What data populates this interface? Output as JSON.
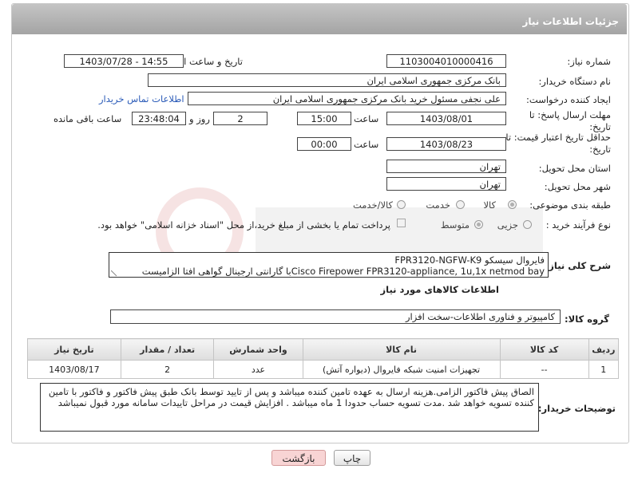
{
  "header": {
    "title": "جزئیات اطلاعات نیاز"
  },
  "fields": {
    "need_number": {
      "label": "شماره نیاز:",
      "value": "1103004010000416"
    },
    "announce_datetime": {
      "label": "تاریخ و ساعت اعلان عمومی:",
      "value": "1403/07/28 - 14:55"
    },
    "buyer_org": {
      "label": "نام دستگاه خریدار:",
      "value": "بانک مرکزی جمهوری اسلامی ایران"
    },
    "requester": {
      "label": "ایجاد کننده درخواست:",
      "value": "علی  نجفی مسئول خرید بانک مرکزی جمهوری اسلامی ایران",
      "contact_link": "اطلاعات تماس خریدار"
    },
    "reply_deadline": {
      "label": "مهلت ارسال پاسخ: تا تاریخ:",
      "date": "1403/08/01",
      "time_label": "ساعت",
      "time": "15:00",
      "days": "2",
      "days_label": "روز و",
      "remaining": "23:48:04",
      "remaining_label": "ساعت باقی مانده"
    },
    "price_validity": {
      "label": "حداقل تاریخ اعتبار قیمت: تا تاریخ:",
      "date": "1403/08/23",
      "time_label": "ساعت",
      "time": "00:00"
    },
    "province": {
      "label": "استان محل تحویل:",
      "value": "تهران"
    },
    "city": {
      "label": "شهر محل تحویل:",
      "value": "تهران"
    },
    "category": {
      "label": "طبقه بندی موضوعی:",
      "options": [
        "کالا",
        "خدمت",
        "کالا/خدمت"
      ]
    },
    "purchase_type": {
      "label": "نوع فرآیند خرید :",
      "options": [
        "جزیی",
        "متوسط"
      ],
      "note": "پرداخت تمام یا بخشی از مبلغ خرید،از محل \"اسناد خزانه اسلامی\" خواهد بود."
    }
  },
  "summary": {
    "label": "شرح کلی نیاز:",
    "line1": "فایروال سیسکو FPR3120-NGFW-K9",
    "line2": "Cisco Firepower FPR3120-appliance, 1u,1x netmod bayبا گارانتی ارجینال گواهی افتا الزامیست"
  },
  "goods_section": {
    "title": "اطلاعات کالاهای مورد نیاز"
  },
  "goods_group": {
    "label": "گروه کالا:",
    "value": "کامپیوتر و فناوری اطلاعات-سخت افزار"
  },
  "table": {
    "headers": [
      "ردیف",
      "کد کالا",
      "نام کالا",
      "واحد شمارش",
      "تعداد / مقدار",
      "تاریخ نیاز"
    ],
    "rows": [
      [
        "1",
        "--",
        "تجهیزات امنیت شبکه فایروال (دیواره آتش)",
        "عدد",
        "2",
        "1403/08/17"
      ]
    ]
  },
  "buyer_notes": {
    "label": "توضیحات خریدار:",
    "text": "الصاق پیش فاکتور الزامی.هزینه ارسال به عهده تامین کننده میباشد و پس از تایید توسط بانک طبق پیش فاکتور و فاکتور با تامین کننده تسویه خواهد شد .مدت تسویه حساب حدودا 1 ماه میباشد . افزایش قیمت در مراحل تاییدات سامانه مورد قبول نمیباشد"
  },
  "buttons": {
    "print": "چاپ",
    "back": "بازگشت"
  },
  "colors": {
    "header": "#b4b4b4",
    "link": "#2b5bb8",
    "back_button": "#f8d4d4"
  }
}
